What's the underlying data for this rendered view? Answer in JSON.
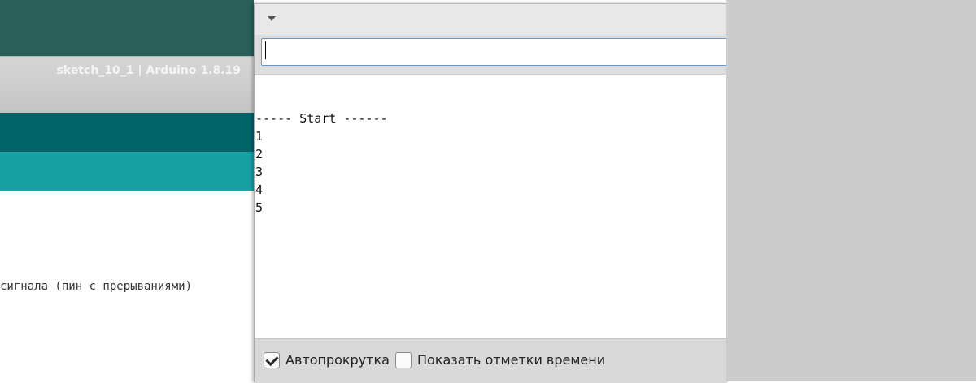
{
  "ide": {
    "title": "sketch_10_1 | Arduino 1.8.19",
    "code_line": "сигнала (пин с прерываниями)"
  },
  "serial_monitor": {
    "input": {
      "value": "",
      "placeholder": ""
    },
    "output_lines": [
      "----- Start ------",
      "1",
      "2",
      "3",
      "4",
      "5"
    ],
    "autoscroll": {
      "label": "Автопрокрутка",
      "checked": true
    },
    "timestamps": {
      "label": "Показать отметки времени",
      "checked": false
    }
  },
  "colors": {
    "ide_topbar": "#2a5f5a",
    "ide_toolbar": "#006468",
    "ide_tabbar": "#17a1a5",
    "input_border": "#6b95d2",
    "desktop": "#cccccc"
  }
}
